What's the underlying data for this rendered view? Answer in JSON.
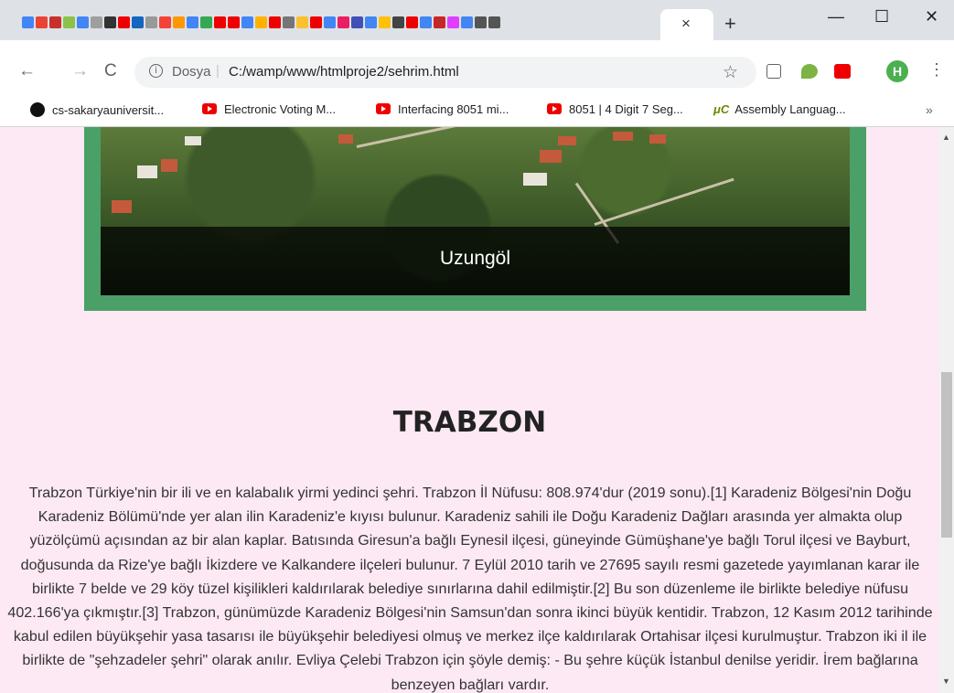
{
  "browser": {
    "tab_close": "×",
    "new_tab": "+",
    "window_controls": {
      "minimize": "—",
      "maximize": "☐",
      "close": "✕"
    },
    "nav": {
      "back": "←",
      "forward": "→",
      "reload": "C"
    },
    "omnibox": {
      "info_icon": "i",
      "scheme": "Dosya",
      "separator": "|",
      "url": "C:/wamp/www/htmlproje2/sehrim.html"
    },
    "star": "☆",
    "avatar": "H",
    "menu": "⋮",
    "bookmarks": [
      {
        "label": "cs-sakaryauniversit...",
        "icon": "github-icon"
      },
      {
        "label": "Electronic Voting M...",
        "icon": "youtube-icon"
      },
      {
        "label": "Interfacing 8051 mi...",
        "icon": "youtube-icon"
      },
      {
        "label": "8051 | 4 Digit 7 Seg...",
        "icon": "youtube-icon"
      },
      {
        "label": "Assembly Languag...",
        "icon": "uc-icon",
        "icon_text": "μC"
      }
    ],
    "bookmarks_more": "»"
  },
  "page": {
    "caption": "Uzungöl",
    "title": "TRABZON",
    "paragraph": "Trabzon Türkiye'nin bir ili ve en kalabalık yirmi yedinci şehri. Trabzon İl Nüfusu: 808.974'dur (2019 sonu).[1] Karadeniz Bölgesi'nin Doğu Karadeniz Bölümü'nde yer alan ilin Karadeniz'e kıyısı bulunur. Karadeniz sahili ile Doğu Karadeniz Dağları arasında yer almakta olup yüzölçümü açısından az bir alan kaplar. Batısında Giresun'a bağlı Eynesil ilçesi, güneyinde Gümüşhane'ye bağlı Torul ilçesi ve Bayburt, doğusunda da Rize'ye bağlı İkizdere ve Kalkandere ilçeleri bulunur. 7 Eylül 2010 tarih ve 27695 sayılı resmi gazetede yayımlanan karar ile birlikte 7 belde ve 29 köy tüzel kişilikleri kaldırılarak belediye sınırlarına dahil edilmiştir.[2] Bu son düzenleme ile birlikte belediye nüfusu 402.166'ya çıkmıştır.[3] Trabzon, günümüzde Karadeniz Bölgesi'nin Samsun'dan sonra ikinci büyük kentidir. Trabzon, 12 Kasım 2012 tarihinde kabul edilen büyükşehir yasa tasarısı ile büyükşehir belediyesi olmuş ve merkez ilçe kaldırılarak Ortahisar ilçesi kurulmuştur. Trabzon iki il ile birlikte de \"şehzadeler şehri\" olarak anılır. Evliya Çelebi Trabzon için şöyle demiş: - Bu şehre küçük İstanbul denilse yeridir. İrem bağlarına benzeyen bağları vardır."
  },
  "colors": {
    "page_bg": "#fde9f3",
    "frame_green": "#4aa066",
    "chrome_bg": "#dee1e6"
  }
}
